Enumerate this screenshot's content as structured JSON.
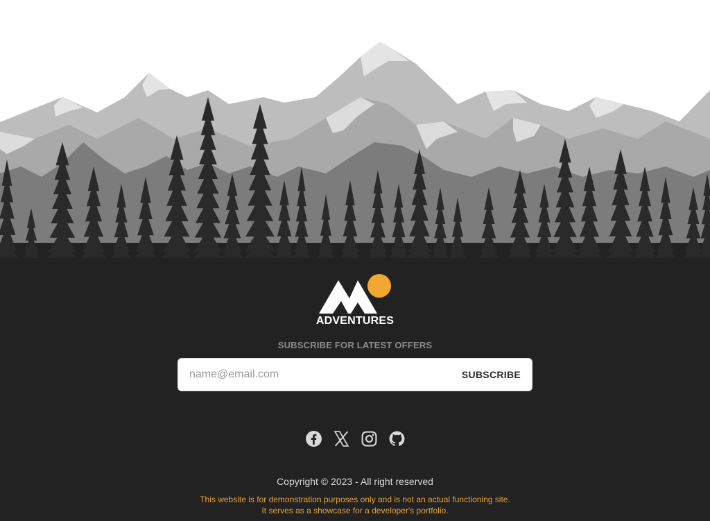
{
  "brand": {
    "name": "ADVENTURES"
  },
  "subscribe": {
    "heading": "SUBSCRIBE FOR LATEST OFFERS",
    "placeholder": "name@email.com",
    "value": "",
    "button_label": "SUBSCRIBE"
  },
  "socials": [
    {
      "name": "facebook-icon"
    },
    {
      "name": "x-icon"
    },
    {
      "name": "instagram-icon"
    },
    {
      "name": "github-icon"
    }
  ],
  "footer": {
    "copyright": "Copyright © 2023 - All right reserved",
    "disclaimer_line1": "This website is for demonstration purposes only and is not an actual functioning site.",
    "disclaimer_line2": "It serves as a showcase for a developer's portfolio."
  },
  "colors": {
    "footer_bg": "#222222",
    "accent": "#f0a830",
    "subscribe_heading": "#8c8c8c",
    "disclaimer": "#e8a33a"
  }
}
